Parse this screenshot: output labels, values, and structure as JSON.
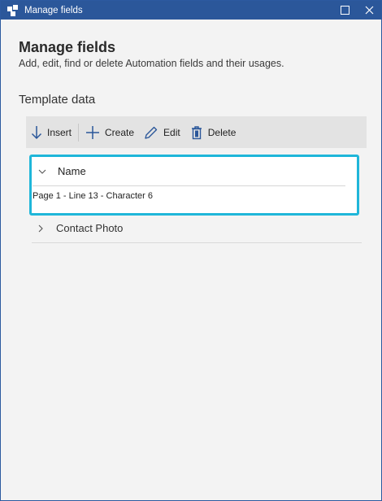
{
  "window": {
    "title": "Manage fields",
    "accent_color": "#2b579a",
    "controls": {
      "maximize_icon": "maximize-icon",
      "close_icon": "close-icon"
    }
  },
  "header": {
    "title": "Manage fields",
    "subtitle": "Add, edit, find or delete Automation fields and their usages."
  },
  "section": {
    "title": "Template data"
  },
  "toolbar": {
    "insert_label": "Insert",
    "create_label": "Create",
    "edit_label": "Edit",
    "delete_label": "Delete"
  },
  "fields": [
    {
      "name": "Name",
      "expanded": true,
      "selected": true,
      "selection_color": "#1fb6d9",
      "usages": [
        "Page 1 - Line 13 - Character 6"
      ]
    },
    {
      "name": "Contact Photo",
      "expanded": false
    }
  ]
}
